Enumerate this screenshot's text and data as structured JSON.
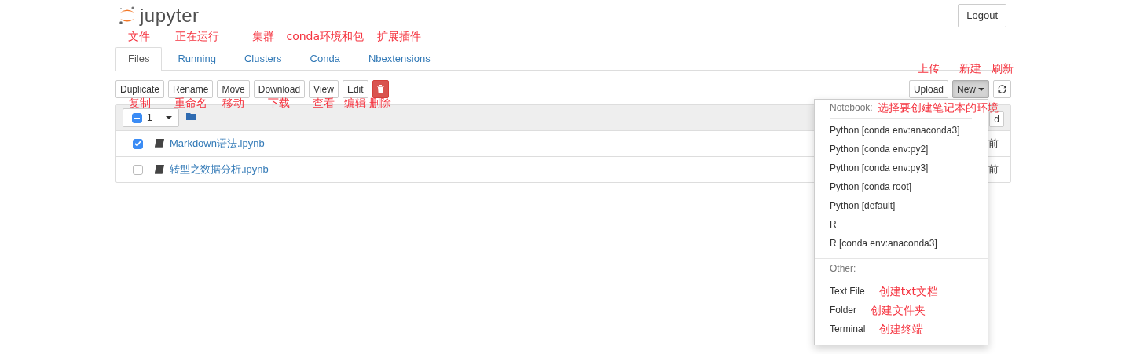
{
  "header": {
    "logo_text": "jupyter",
    "logout": "Logout"
  },
  "tabs": [
    {
      "label": "Files",
      "selected": true,
      "annotation": "文件"
    },
    {
      "label": "Running",
      "selected": false,
      "annotation": "正在运行"
    },
    {
      "label": "Clusters",
      "selected": false,
      "annotation": "集群"
    },
    {
      "label": "Conda",
      "selected": false,
      "annotation": "conda环境和包"
    },
    {
      "label": "Nbextensions",
      "selected": false,
      "annotation": "扩展插件"
    }
  ],
  "toolbar_left": [
    {
      "kind": "text",
      "label": "Duplicate",
      "annotation": "复制"
    },
    {
      "kind": "text",
      "label": "Rename",
      "annotation": "重命名"
    },
    {
      "kind": "text",
      "label": "Move",
      "annotation": "移动"
    },
    {
      "kind": "text",
      "label": "Download",
      "annotation": "下载"
    },
    {
      "kind": "text",
      "label": "View",
      "annotation": "查看"
    },
    {
      "kind": "text",
      "label": "Edit",
      "annotation": "编辑"
    },
    {
      "kind": "delete",
      "annotation": "删除"
    }
  ],
  "toolbar_right": [
    {
      "kind": "text",
      "label": "Upload",
      "annotation": "上传"
    },
    {
      "kind": "dropdown",
      "label": "New",
      "annotation": "新建"
    },
    {
      "kind": "refresh",
      "annotation": "刷新"
    }
  ],
  "list_header": {
    "partially_selected": true,
    "selected_count": "1",
    "right_button": "d"
  },
  "rows": [
    {
      "name": "Markdown语法.ipynb",
      "checked": true,
      "modified": "前"
    },
    {
      "name": "转型之数据分析.ipynb",
      "checked": false,
      "modified": "前"
    }
  ],
  "new_menu": {
    "sections": [
      {
        "header": "Notebook:",
        "annotation": "选择要创建笔记本的环境",
        "items": [
          {
            "label": "Python [conda env:anaconda3]"
          },
          {
            "label": "Python [conda env:py2]"
          },
          {
            "label": "Python [conda env:py3]"
          },
          {
            "label": "Python [conda root]"
          },
          {
            "label": "Python [default]"
          },
          {
            "label": "R"
          },
          {
            "label": "R [conda env:anaconda3]"
          }
        ]
      },
      {
        "header": "Other:",
        "items": [
          {
            "label": "Text File",
            "annotation": "创建txt文档"
          },
          {
            "label": "Folder",
            "annotation": "创建文件夹"
          },
          {
            "label": "Terminal",
            "annotation": "创建终端"
          }
        ]
      }
    ]
  }
}
